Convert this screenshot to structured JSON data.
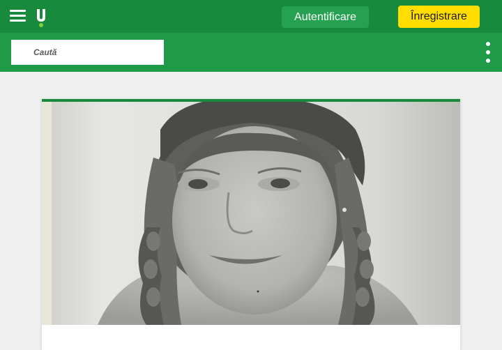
{
  "header": {
    "menu_icon": "hamburger-menu-icon",
    "logo_icon": "unica-logo-icon",
    "login_label": "Autentificare",
    "register_label": "Înregistrare",
    "colors": {
      "topbar": "#178a3d",
      "searchbar": "#1f9a47",
      "login_button": "#26a152",
      "register_button": "#ffdd00"
    }
  },
  "search": {
    "placeholder": "Caută",
    "more_icon": "vertical-dots-icon"
  },
  "article": {
    "image_alt": "Black and white photo of a smiling girl with braided hair"
  }
}
